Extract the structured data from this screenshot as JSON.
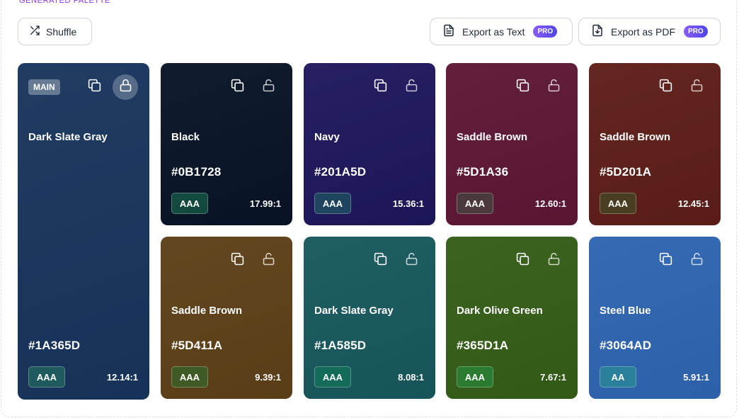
{
  "section_label": "GENERATED PALETTE",
  "toolbar": {
    "shuffle_label": "Shuffle",
    "export_text_label": "Export as Text",
    "export_pdf_label": "Export as PDF",
    "pro_badge": "PRO"
  },
  "main_tag": "MAIN",
  "cards": [
    {
      "name": "Dark Slate Gray",
      "hex": "#1A365D",
      "rating": "AAA",
      "ratio": "12.14:1",
      "color": "#1A365D",
      "badge_color": "#1f5a5e",
      "locked": true
    },
    {
      "name": "Black",
      "hex": "#0B1728",
      "rating": "AAA",
      "ratio": "17.99:1",
      "color": "#0B1728",
      "badge_color": "#134a40",
      "locked": false
    },
    {
      "name": "Navy",
      "hex": "#201A5D",
      "rating": "AAA",
      "ratio": "15.36:1",
      "color": "#201A5D",
      "badge_color": "#1e4460",
      "locked": false
    },
    {
      "name": "Saddle Brown",
      "hex": "#5D1A36",
      "rating": "AAA",
      "ratio": "12.60:1",
      "color": "#5D1A36",
      "badge_color": "#4a3a3c",
      "locked": false
    },
    {
      "name": "Saddle Brown",
      "hex": "#5D201A",
      "rating": "AAA",
      "ratio": "12.45:1",
      "color": "#5D201A",
      "badge_color": "#4a3e22",
      "locked": false
    },
    {
      "name": "Saddle Brown",
      "hex": "#5D411A",
      "rating": "AAA",
      "ratio": "9.39:1",
      "color": "#5D411A",
      "badge_color": "#405a25",
      "locked": false
    },
    {
      "name": "Dark Slate Gray",
      "hex": "#1A585D",
      "rating": "AAA",
      "ratio": "8.08:1",
      "color": "#1A585D",
      "badge_color": "#156b5a",
      "locked": false
    },
    {
      "name": "Dark Olive Green",
      "hex": "#365D1A",
      "rating": "AAA",
      "ratio": "7.67:1",
      "color": "#365D1A",
      "badge_color": "#2a7a30",
      "locked": false
    },
    {
      "name": "Steel Blue",
      "hex": "#3064AD",
      "rating": "AA",
      "ratio": "5.91:1",
      "color": "#3064AD",
      "badge_color": "#2a7f9a",
      "locked": false
    }
  ]
}
